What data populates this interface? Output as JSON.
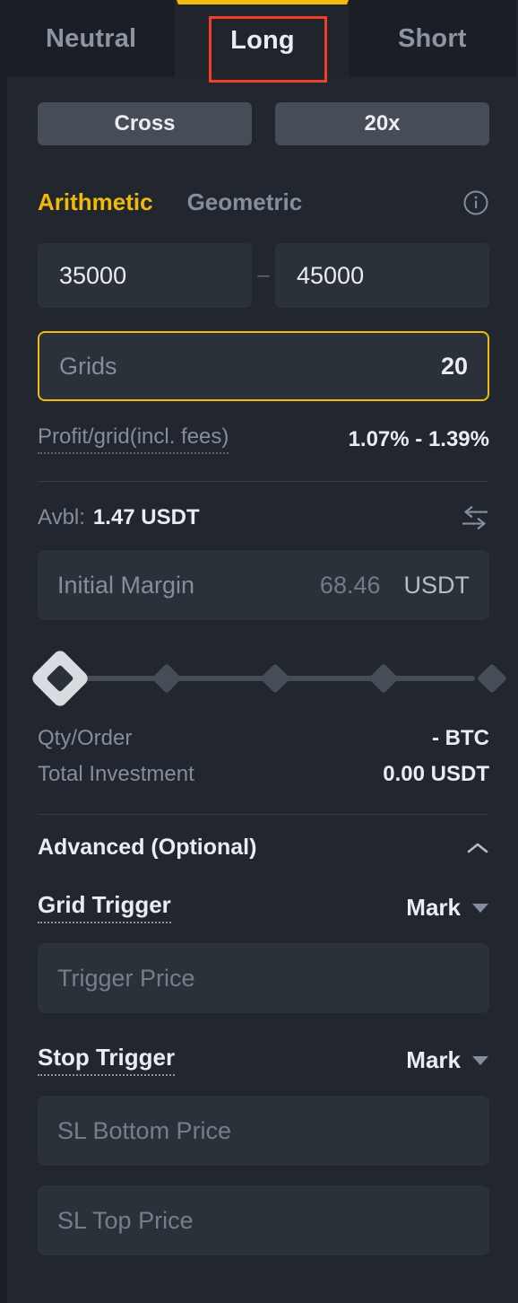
{
  "tabs": [
    {
      "label": "Neutral",
      "active": false
    },
    {
      "label": "Long",
      "active": true
    },
    {
      "label": "Short",
      "active": false
    }
  ],
  "leverage": {
    "margin_mode": "Cross",
    "leverage_value": "20x"
  },
  "mode": {
    "arithmetic": "Arithmetic",
    "geometric": "Geometric",
    "info_icon": "info-icon"
  },
  "price_range": {
    "lower_value": "35000",
    "upper_value": "45000",
    "separator": "–"
  },
  "grids": {
    "placeholder": "Grids",
    "value": "20"
  },
  "profit": {
    "label": "Profit/grid(incl. fees)",
    "value": "1.07% - 1.39%"
  },
  "available": {
    "label": "Avbl:",
    "value": "1.47 USDT",
    "swap_icon": "transfer-arrows-icon"
  },
  "initial_margin": {
    "placeholder": "Initial Margin",
    "amount": "68.46",
    "unit": "USDT"
  },
  "slider": {
    "handle_position_pct": 0,
    "ticks_pct": [
      0,
      25,
      50,
      75,
      100
    ]
  },
  "summary": [
    {
      "label": "Qty/Order",
      "value": "- BTC"
    },
    {
      "label": "Total Investment",
      "value": "0.00 USDT"
    }
  ],
  "advanced": {
    "title": "Advanced (Optional)",
    "chevron_icon": "chevron-up-icon",
    "grid_trigger": {
      "label": "Grid Trigger",
      "selected": "Mark",
      "input_placeholder": "Trigger Price"
    },
    "stop_trigger": {
      "label": "Stop Trigger",
      "selected": "Mark",
      "sl_bottom_placeholder": "SL Bottom Price",
      "sl_top_placeholder": "SL Top Price"
    }
  },
  "colors": {
    "accent": "#f0b90b",
    "annotation": "#f23e2c",
    "panel_bg": "#22262e",
    "field_bg": "#2b3139",
    "muted_text": "#848e9c",
    "primary_text": "#eaecef"
  }
}
